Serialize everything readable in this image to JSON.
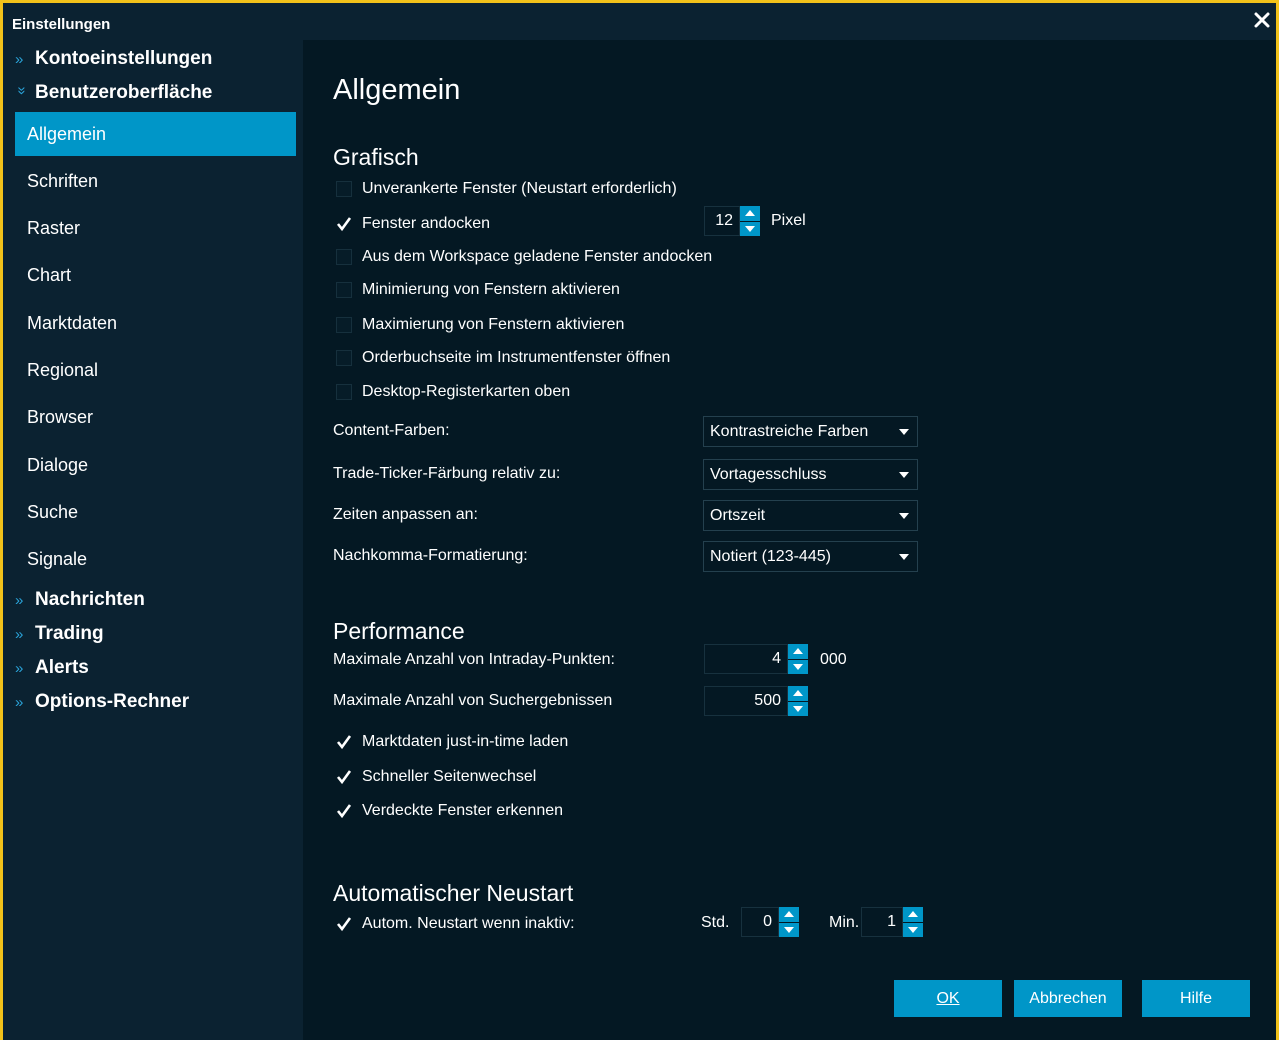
{
  "window": {
    "title": "Einstellungen"
  },
  "sidebar": {
    "groups": {
      "konto": "Kontoeinstellungen",
      "benutzer": "Benutzeroberfläche",
      "nachrichten": "Nachrichten",
      "trading": "Trading",
      "alerts": "Alerts",
      "options": "Options-Rechner"
    },
    "chevrons": {
      "collapsed": "»",
      "expanded": "»"
    },
    "items": [
      "Allgemein",
      "Schriften",
      "Raster",
      "Chart",
      "Marktdaten",
      "Regional",
      "Browser",
      "Dialoge",
      "Suche",
      "Signale"
    ],
    "active_item": "Allgemein"
  },
  "content": {
    "title": "Allgemein",
    "grafisch": {
      "heading": "Grafisch",
      "checkboxes": [
        {
          "label": "Unverankerte Fenster (Neustart erforderlich)",
          "checked": false
        },
        {
          "label": "Fenster andocken",
          "checked": true
        },
        {
          "label": "Aus dem Workspace geladene Fenster andocken",
          "checked": false
        },
        {
          "label": "Minimierung von Fenstern aktivieren",
          "checked": false
        },
        {
          "label": "Maximierung von Fenstern aktivieren",
          "checked": false
        },
        {
          "label": "Orderbuchseite im Instrumentfenster öffnen",
          "checked": false
        },
        {
          "label": "Desktop-Registerkarten oben",
          "checked": false
        }
      ],
      "dock_pixels": "12",
      "dock_unit": "Pixel",
      "dropdowns": [
        {
          "label": "Content-Farben:",
          "value": "Kontrastreiche Farben"
        },
        {
          "label": "Trade-Ticker-Färbung relativ zu:",
          "value": "Vortagesschluss"
        },
        {
          "label": "Zeiten anpassen an:",
          "value": "Ortszeit"
        },
        {
          "label": "Nachkomma-Formatierung:",
          "value": "Notiert (123-445)"
        }
      ]
    },
    "performance": {
      "heading": "Performance",
      "intraday_label": "Maximale Anzahl von Intraday-Punkten:",
      "intraday_value": "4",
      "intraday_unit": "000",
      "search_label": "Maximale Anzahl von Suchergebnissen",
      "search_value": "500",
      "checkboxes": [
        {
          "label": "Marktdaten just-in-time laden",
          "checked": true
        },
        {
          "label": "Schneller Seitenwechsel",
          "checked": true
        },
        {
          "label": "Verdeckte Fenster erkennen",
          "checked": true
        }
      ]
    },
    "restart": {
      "heading": "Automatischer Neustart",
      "checkbox": {
        "label": "Autom. Neustart wenn inaktiv:",
        "checked": true
      },
      "hours_label": "Std.",
      "hours_value": "0",
      "minutes_label": "Min.",
      "minutes_value": "1"
    }
  },
  "buttons": {
    "ok": "OK",
    "cancel": "Abbrechen",
    "help": "Hilfe"
  },
  "colors": {
    "accent": "#0096c8",
    "border": "#f2c21a",
    "sidebar_bg": "#0b2231",
    "content_bg": "#041823"
  }
}
